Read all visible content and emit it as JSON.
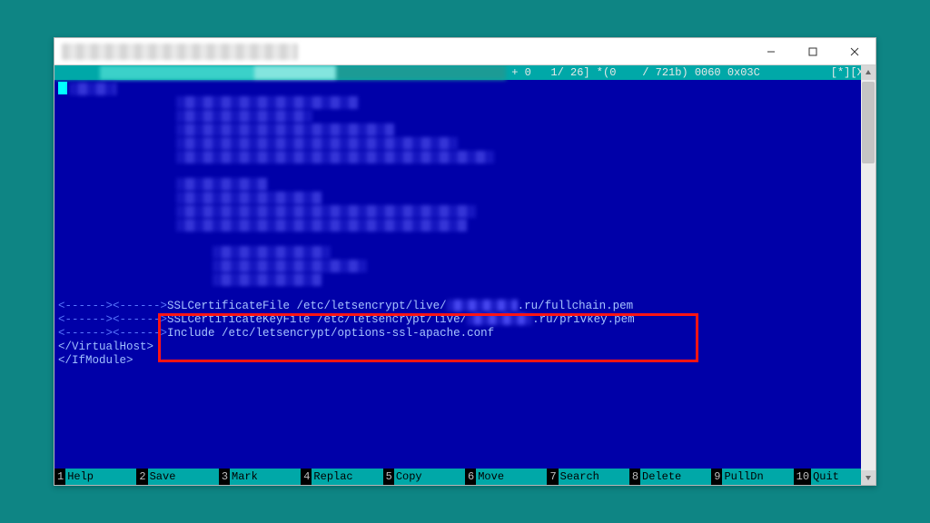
{
  "titlebar": {
    "title_hidden": true
  },
  "status": {
    "right": "+ 0   1/ 26] *(0    / 721b) 0060 0x03C",
    "flags": "[*][X]"
  },
  "lines": {
    "ssl_cert_prefix": "SSLCertificateFile /etc/letsencrypt/live/",
    "ssl_cert_suffix": ".ru/fullchain.pem",
    "ssl_key_prefix": "SSLCertificateKeyFile /etc/letsencrypt/live/",
    "ssl_key_suffix": ".ru/privkey.pem",
    "include": "Include /etc/letsencrypt/options-ssl-apache.conf",
    "close_vhost": "</VirtualHost>",
    "close_ifmodule": "</IfModule>",
    "dash_lead": "<------><------>"
  },
  "fkeys": [
    {
      "n": "1",
      "l": "Help"
    },
    {
      "n": "2",
      "l": "Save"
    },
    {
      "n": "3",
      "l": "Mark"
    },
    {
      "n": "4",
      "l": "Replac"
    },
    {
      "n": "5",
      "l": "Copy"
    },
    {
      "n": "6",
      "l": "Move"
    },
    {
      "n": "7",
      "l": "Search"
    },
    {
      "n": "8",
      "l": "Delete"
    },
    {
      "n": "9",
      "l": "PullDn"
    },
    {
      "n": "10",
      "l": "Quit"
    }
  ]
}
